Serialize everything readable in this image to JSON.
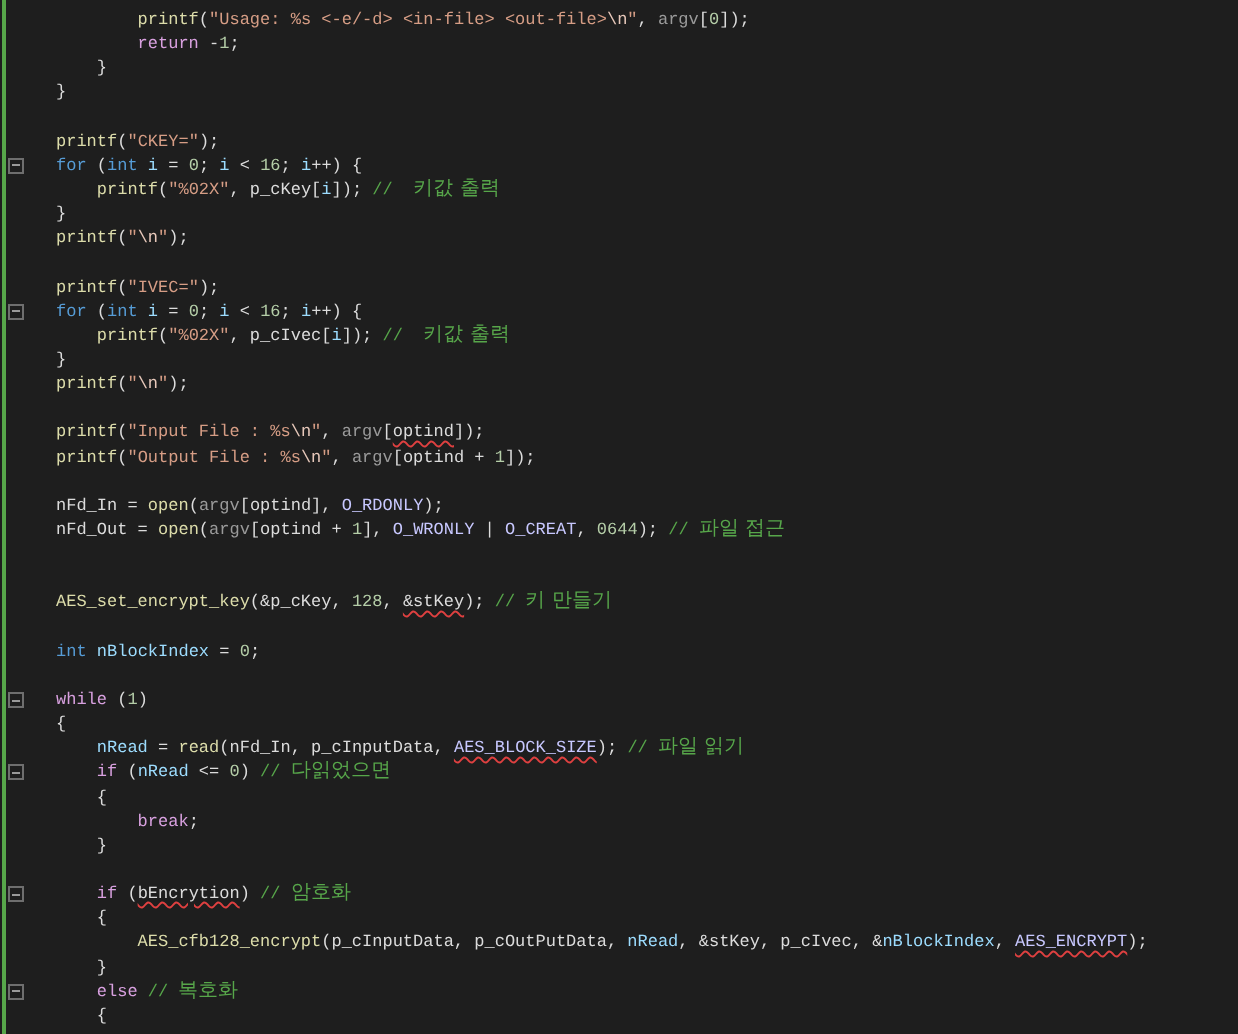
{
  "editor": {
    "lines": [
      {
        "kind": "code",
        "tokens": [
          {
            "kind": "function",
            "text": "        printf"
          },
          {
            "kind": "plain",
            "text": "("
          },
          {
            "kind": "string",
            "text": "\"Usage: %s <-e/-d> <in-file> <out-file>"
          },
          {
            "kind": "escape",
            "text": "\\n"
          },
          {
            "kind": "string",
            "text": "\""
          },
          {
            "kind": "plain",
            "text": ", "
          },
          {
            "kind": "parameter",
            "text": "argv"
          },
          {
            "kind": "plain",
            "text": "["
          },
          {
            "kind": "number",
            "text": "0"
          },
          {
            "kind": "plain",
            "text": "]);"
          }
        ]
      },
      {
        "kind": "code",
        "tokens": [
          {
            "kind": "control",
            "text": "        return"
          },
          {
            "kind": "plain",
            "text": " -"
          },
          {
            "kind": "number",
            "text": "1"
          },
          {
            "kind": "plain",
            "text": ";"
          }
        ]
      },
      {
        "kind": "code",
        "tokens": [
          {
            "kind": "plain",
            "text": "    }"
          }
        ]
      },
      {
        "kind": "code",
        "tokens": [
          {
            "kind": "plain",
            "text": "}"
          }
        ]
      },
      {
        "kind": "blank"
      },
      {
        "kind": "code",
        "tokens": [
          {
            "kind": "function",
            "text": "printf"
          },
          {
            "kind": "plain",
            "text": "("
          },
          {
            "kind": "string",
            "text": "\"CKEY=\""
          },
          {
            "kind": "plain",
            "text": ");"
          }
        ]
      },
      {
        "kind": "code",
        "foldable": true,
        "tokens": [
          {
            "kind": "keyword",
            "text": "for"
          },
          {
            "kind": "plain",
            "text": " ("
          },
          {
            "kind": "keyword",
            "text": "int"
          },
          {
            "kind": "variable",
            "text": " i"
          },
          {
            "kind": "plain",
            "text": " = "
          },
          {
            "kind": "number",
            "text": "0"
          },
          {
            "kind": "plain",
            "text": "; "
          },
          {
            "kind": "variable",
            "text": "i"
          },
          {
            "kind": "plain",
            "text": " < "
          },
          {
            "kind": "number",
            "text": "16"
          },
          {
            "kind": "plain",
            "text": "; "
          },
          {
            "kind": "variable",
            "text": "i"
          },
          {
            "kind": "plain",
            "text": "++) {"
          }
        ]
      },
      {
        "kind": "code",
        "tokens": [
          {
            "kind": "function",
            "text": "    printf"
          },
          {
            "kind": "plain",
            "text": "("
          },
          {
            "kind": "string",
            "text": "\"%02X\""
          },
          {
            "kind": "plain",
            "text": ", p_cKey["
          },
          {
            "kind": "variable",
            "text": "i"
          },
          {
            "kind": "plain",
            "text": "]); "
          },
          {
            "kind": "comment",
            "text": "//  키값 출력"
          }
        ]
      },
      {
        "kind": "code",
        "tokens": [
          {
            "kind": "plain",
            "text": "}"
          }
        ]
      },
      {
        "kind": "code",
        "tokens": [
          {
            "kind": "function",
            "text": "printf"
          },
          {
            "kind": "plain",
            "text": "("
          },
          {
            "kind": "string",
            "text": "\""
          },
          {
            "kind": "escape",
            "text": "\\n"
          },
          {
            "kind": "string",
            "text": "\""
          },
          {
            "kind": "plain",
            "text": ");"
          }
        ]
      },
      {
        "kind": "blank"
      },
      {
        "kind": "code",
        "tokens": [
          {
            "kind": "function",
            "text": "printf"
          },
          {
            "kind": "plain",
            "text": "("
          },
          {
            "kind": "string",
            "text": "\"IVEC=\""
          },
          {
            "kind": "plain",
            "text": ");"
          }
        ]
      },
      {
        "kind": "code",
        "foldable": true,
        "tokens": [
          {
            "kind": "keyword",
            "text": "for"
          },
          {
            "kind": "plain",
            "text": " ("
          },
          {
            "kind": "keyword",
            "text": "int"
          },
          {
            "kind": "variable",
            "text": " i"
          },
          {
            "kind": "plain",
            "text": " = "
          },
          {
            "kind": "number",
            "text": "0"
          },
          {
            "kind": "plain",
            "text": "; "
          },
          {
            "kind": "variable",
            "text": "i"
          },
          {
            "kind": "plain",
            "text": " < "
          },
          {
            "kind": "number",
            "text": "16"
          },
          {
            "kind": "plain",
            "text": "; "
          },
          {
            "kind": "variable",
            "text": "i"
          },
          {
            "kind": "plain",
            "text": "++) {"
          }
        ]
      },
      {
        "kind": "code",
        "tokens": [
          {
            "kind": "function",
            "text": "    printf"
          },
          {
            "kind": "plain",
            "text": "("
          },
          {
            "kind": "string",
            "text": "\"%02X\""
          },
          {
            "kind": "plain",
            "text": ", p_cIvec["
          },
          {
            "kind": "variable",
            "text": "i"
          },
          {
            "kind": "plain",
            "text": "]); "
          },
          {
            "kind": "comment",
            "text": "//  키값 출력"
          }
        ]
      },
      {
        "kind": "code",
        "tokens": [
          {
            "kind": "plain",
            "text": "}"
          }
        ]
      },
      {
        "kind": "code",
        "tokens": [
          {
            "kind": "function",
            "text": "printf"
          },
          {
            "kind": "plain",
            "text": "("
          },
          {
            "kind": "string",
            "text": "\""
          },
          {
            "kind": "escape",
            "text": "\\n"
          },
          {
            "kind": "string",
            "text": "\""
          },
          {
            "kind": "plain",
            "text": ");"
          }
        ]
      },
      {
        "kind": "blank"
      },
      {
        "kind": "code",
        "tokens": [
          {
            "kind": "function",
            "text": "printf"
          },
          {
            "kind": "plain",
            "text": "("
          },
          {
            "kind": "string",
            "text": "\"Input File : %s"
          },
          {
            "kind": "escape",
            "text": "\\n"
          },
          {
            "kind": "string",
            "text": "\""
          },
          {
            "kind": "plain",
            "text": ", "
          },
          {
            "kind": "parameter",
            "text": "argv"
          },
          {
            "kind": "plain",
            "text": "["
          },
          {
            "kind": "plain",
            "text": "optind",
            "squiggle": true
          },
          {
            "kind": "plain",
            "text": "]);"
          }
        ]
      },
      {
        "kind": "code",
        "tokens": [
          {
            "kind": "function",
            "text": "printf"
          },
          {
            "kind": "plain",
            "text": "("
          },
          {
            "kind": "string",
            "text": "\"Output File : %s"
          },
          {
            "kind": "escape",
            "text": "\\n"
          },
          {
            "kind": "string",
            "text": "\""
          },
          {
            "kind": "plain",
            "text": ", "
          },
          {
            "kind": "parameter",
            "text": "argv"
          },
          {
            "kind": "plain",
            "text": "[optind + "
          },
          {
            "kind": "number",
            "text": "1"
          },
          {
            "kind": "plain",
            "text": "]);"
          }
        ]
      },
      {
        "kind": "blank"
      },
      {
        "kind": "code",
        "tokens": [
          {
            "kind": "plain",
            "text": "nFd_In = "
          },
          {
            "kind": "function",
            "text": "open"
          },
          {
            "kind": "plain",
            "text": "("
          },
          {
            "kind": "parameter",
            "text": "argv"
          },
          {
            "kind": "plain",
            "text": "[optind], "
          },
          {
            "kind": "macro",
            "text": "O_RDONLY"
          },
          {
            "kind": "plain",
            "text": ");"
          }
        ]
      },
      {
        "kind": "code",
        "tokens": [
          {
            "kind": "plain",
            "text": "nFd_Out = "
          },
          {
            "kind": "function",
            "text": "open"
          },
          {
            "kind": "plain",
            "text": "("
          },
          {
            "kind": "parameter",
            "text": "argv"
          },
          {
            "kind": "plain",
            "text": "[optind + "
          },
          {
            "kind": "number",
            "text": "1"
          },
          {
            "kind": "plain",
            "text": "], "
          },
          {
            "kind": "macro",
            "text": "O_WRONLY"
          },
          {
            "kind": "plain",
            "text": " | "
          },
          {
            "kind": "macro",
            "text": "O_CREAT"
          },
          {
            "kind": "plain",
            "text": ", "
          },
          {
            "kind": "number",
            "text": "0644"
          },
          {
            "kind": "plain",
            "text": "); "
          },
          {
            "kind": "comment",
            "text": "// 파일 접근"
          }
        ]
      },
      {
        "kind": "blank"
      },
      {
        "kind": "blank"
      },
      {
        "kind": "code",
        "tokens": [
          {
            "kind": "function",
            "text": "AES_set_encrypt_key"
          },
          {
            "kind": "plain",
            "text": "(&p_cKey, "
          },
          {
            "kind": "number",
            "text": "128"
          },
          {
            "kind": "plain",
            "text": ", "
          },
          {
            "kind": "plain",
            "text": "&stKey",
            "squiggle": true
          },
          {
            "kind": "plain",
            "text": "); "
          },
          {
            "kind": "comment",
            "text": "// 키 만들기"
          }
        ]
      },
      {
        "kind": "blank"
      },
      {
        "kind": "code",
        "tokens": [
          {
            "kind": "keyword",
            "text": "int"
          },
          {
            "kind": "variable",
            "text": " nBlockIndex"
          },
          {
            "kind": "plain",
            "text": " = "
          },
          {
            "kind": "number",
            "text": "0"
          },
          {
            "kind": "plain",
            "text": ";"
          }
        ]
      },
      {
        "kind": "blank"
      },
      {
        "kind": "code",
        "foldable": true,
        "tokens": [
          {
            "kind": "control",
            "text": "while"
          },
          {
            "kind": "plain",
            "text": " ("
          },
          {
            "kind": "number",
            "text": "1"
          },
          {
            "kind": "plain",
            "text": ")"
          }
        ]
      },
      {
        "kind": "code",
        "tokens": [
          {
            "kind": "plain",
            "text": "{"
          }
        ]
      },
      {
        "kind": "code",
        "tokens": [
          {
            "kind": "variable",
            "text": "    nRead"
          },
          {
            "kind": "plain",
            "text": " = "
          },
          {
            "kind": "function",
            "text": "read"
          },
          {
            "kind": "plain",
            "text": "(nFd_In, p_cInputData, "
          },
          {
            "kind": "macro",
            "text": "AES_BLOCK_SIZE",
            "squiggle": true
          },
          {
            "kind": "plain",
            "text": "); "
          },
          {
            "kind": "comment",
            "text": "// 파일 읽기"
          }
        ]
      },
      {
        "kind": "code",
        "foldable": true,
        "tokens": [
          {
            "kind": "control",
            "text": "    if"
          },
          {
            "kind": "plain",
            "text": " ("
          },
          {
            "kind": "variable",
            "text": "nRead"
          },
          {
            "kind": "plain",
            "text": " <= "
          },
          {
            "kind": "number",
            "text": "0"
          },
          {
            "kind": "plain",
            "text": ") "
          },
          {
            "kind": "comment",
            "text": "// 다읽었으면"
          }
        ]
      },
      {
        "kind": "code",
        "tokens": [
          {
            "kind": "plain",
            "text": "    {"
          }
        ]
      },
      {
        "kind": "code",
        "tokens": [
          {
            "kind": "control",
            "text": "        break"
          },
          {
            "kind": "plain",
            "text": ";"
          }
        ]
      },
      {
        "kind": "code",
        "tokens": [
          {
            "kind": "plain",
            "text": "    }"
          }
        ]
      },
      {
        "kind": "blank"
      },
      {
        "kind": "code",
        "foldable": true,
        "tokens": [
          {
            "kind": "control",
            "text": "    if"
          },
          {
            "kind": "plain",
            "text": " ("
          },
          {
            "kind": "plain",
            "text": "bEncrytion",
            "squiggle": true
          },
          {
            "kind": "plain",
            "text": ") "
          },
          {
            "kind": "comment",
            "text": "// 암호화"
          }
        ]
      },
      {
        "kind": "code",
        "tokens": [
          {
            "kind": "plain",
            "text": "    {"
          }
        ]
      },
      {
        "kind": "code",
        "tokens": [
          {
            "kind": "function",
            "text": "        AES_cfb128_encrypt"
          },
          {
            "kind": "plain",
            "text": "(p_cInputData, p_cOutPutData, "
          },
          {
            "kind": "variable",
            "text": "nRead"
          },
          {
            "kind": "plain",
            "text": ", &stKey, p_cIvec, &"
          },
          {
            "kind": "variable",
            "text": "nBlockIndex"
          },
          {
            "kind": "plain",
            "text": ", "
          },
          {
            "kind": "macro",
            "text": "AES_ENCRYPT",
            "squiggle": true
          },
          {
            "kind": "plain",
            "text": ");"
          }
        ]
      },
      {
        "kind": "code",
        "tokens": [
          {
            "kind": "plain",
            "text": "    }"
          }
        ]
      },
      {
        "kind": "code",
        "foldable": true,
        "tokens": [
          {
            "kind": "control",
            "text": "    else"
          },
          {
            "kind": "comment",
            "text": " // 복호화"
          }
        ]
      },
      {
        "kind": "code",
        "tokens": [
          {
            "kind": "plain",
            "text": "    {"
          }
        ]
      }
    ]
  }
}
